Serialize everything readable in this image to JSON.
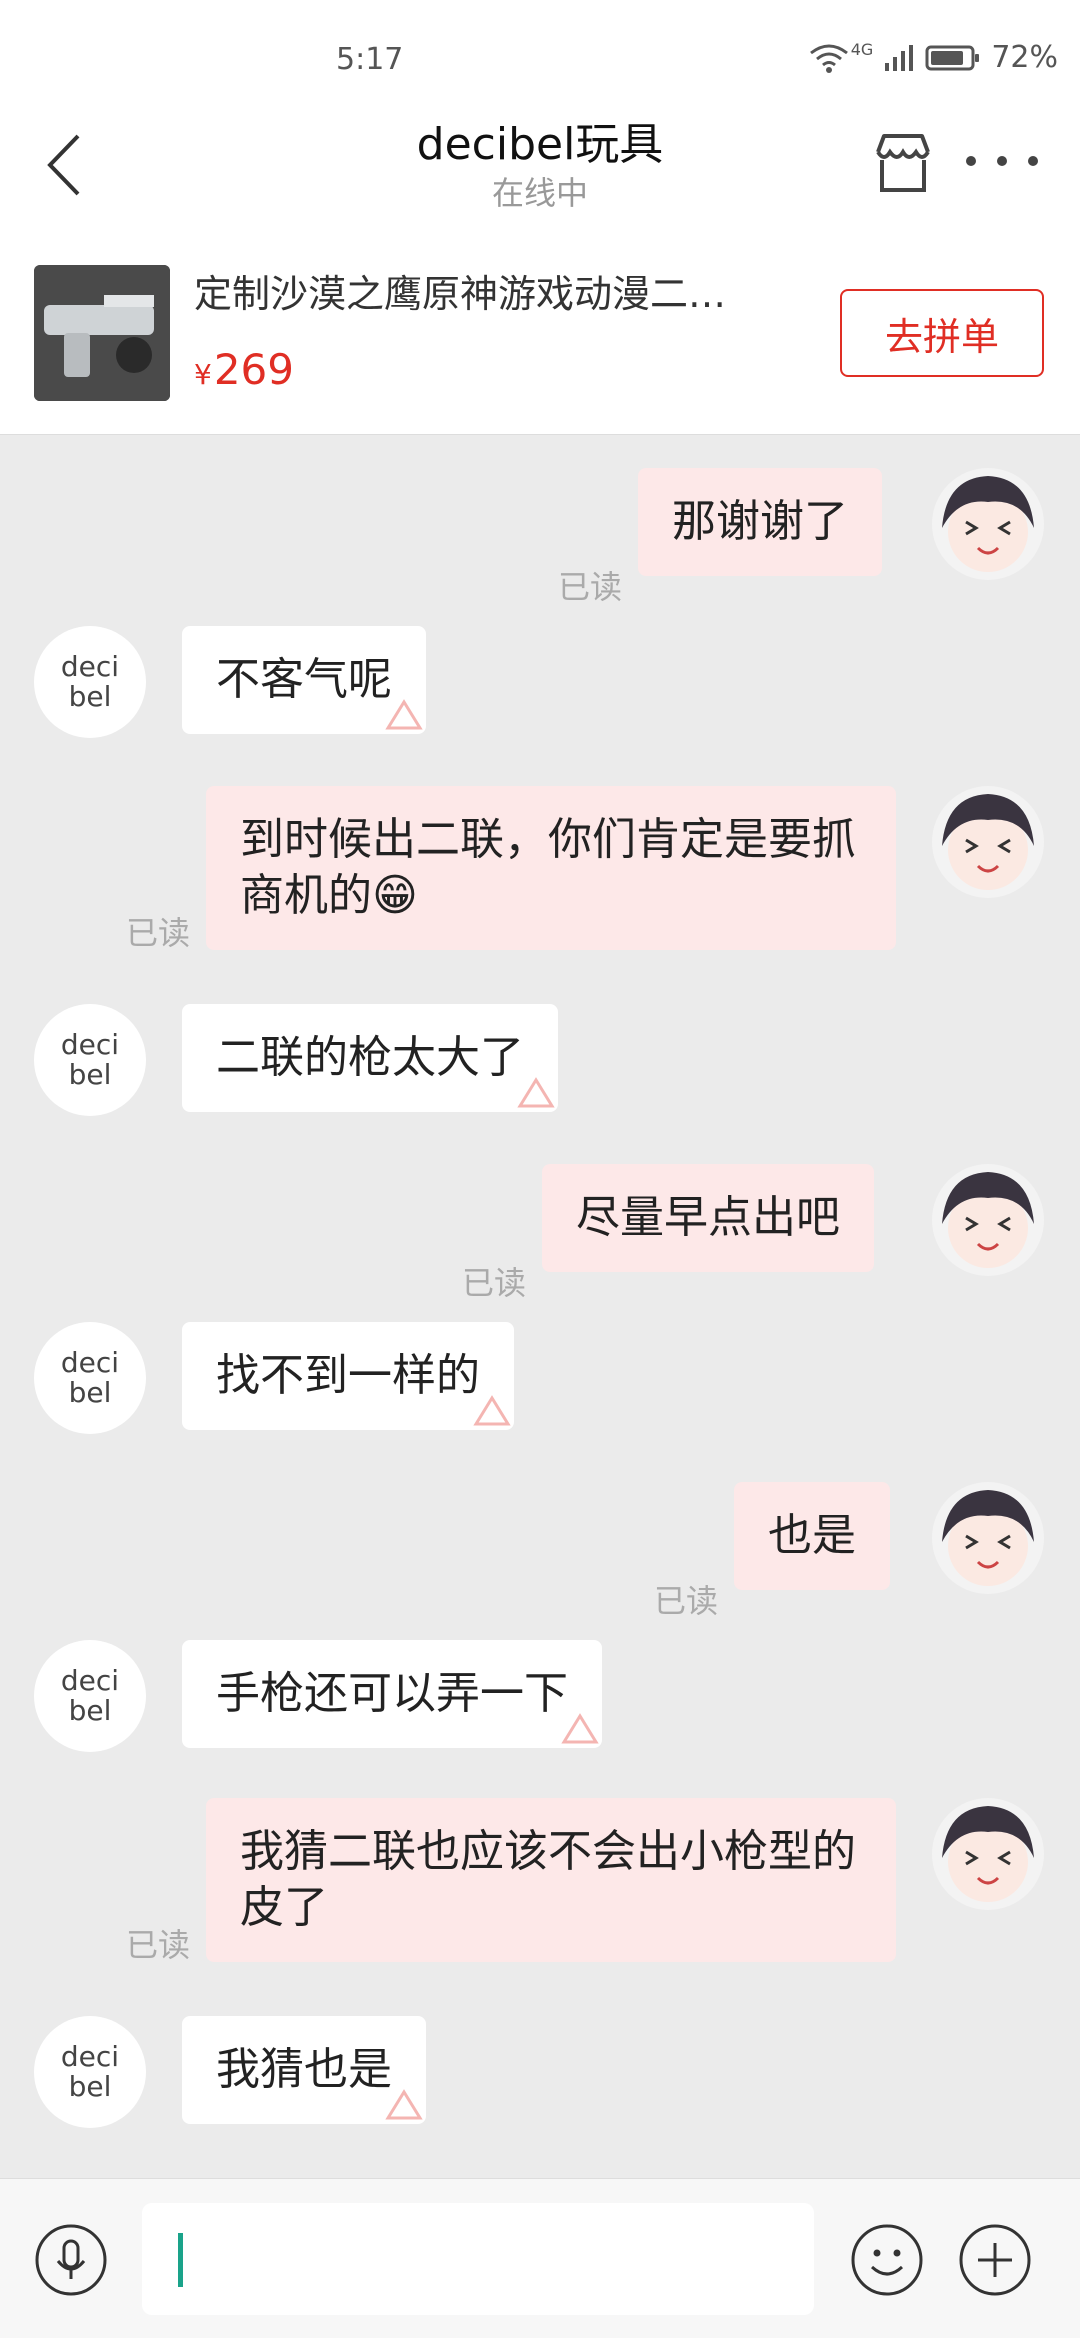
{
  "status_bar": {
    "time": "5:17",
    "network": "4G",
    "battery": "72%"
  },
  "header": {
    "title": "decibel玩具",
    "subtitle": "在线中"
  },
  "product": {
    "title": "定制沙漠之鹰原神游戏动漫二…",
    "currency": "¥",
    "price": "269",
    "button_label": "去拼单"
  },
  "them_avatar": {
    "line1": "deci",
    "line2": "bel"
  },
  "read_label": "已读",
  "messages": [
    {
      "from": "me",
      "text": "那谢谢了",
      "status": "已读"
    },
    {
      "from": "them",
      "text": "不客气呢"
    },
    {
      "from": "me",
      "text": "到时候出二联，你们肯定是要抓商机的😁",
      "status": "已读"
    },
    {
      "from": "them",
      "text": "二联的枪太大了"
    },
    {
      "from": "me",
      "text": "尽量早点出吧",
      "status": "已读"
    },
    {
      "from": "them",
      "text": "找不到一样的"
    },
    {
      "from": "me",
      "text": "也是",
      "status": "已读"
    },
    {
      "from": "them",
      "text": "手枪还可以弄一下"
    },
    {
      "from": "me",
      "text": "我猜二联也应该不会出小枪型的皮了",
      "status": "已读"
    },
    {
      "from": "them",
      "text": "我猜也是"
    }
  ],
  "input": {
    "value": ""
  },
  "colors": {
    "accent": "#e02e24",
    "my_bubble": "#fde8e8",
    "background": "#ebebeb",
    "caret": "#1aa38a"
  },
  "icons": [
    "back-icon",
    "shop-icon",
    "more-icon",
    "mic-icon",
    "emoji-icon",
    "plus-icon",
    "wifi-icon",
    "signal-icon",
    "battery-icon"
  ]
}
